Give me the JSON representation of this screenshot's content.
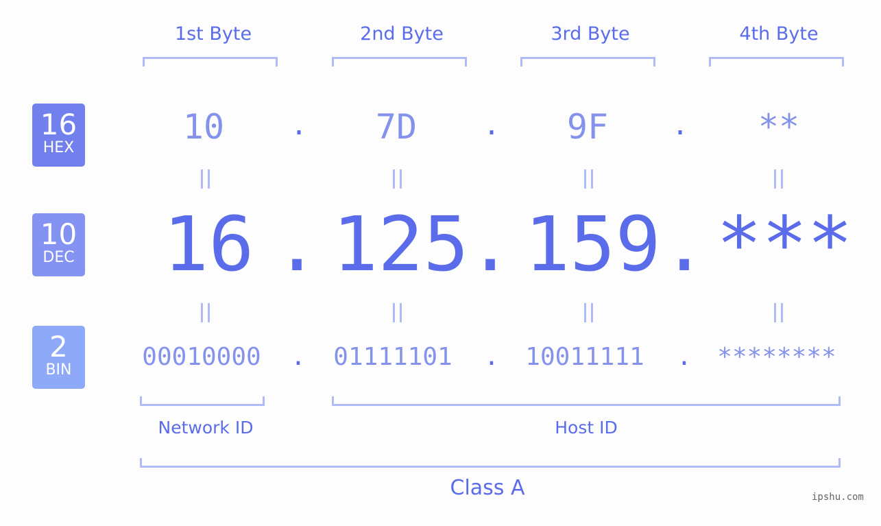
{
  "bytes": [
    {
      "label": "1st Byte",
      "hex": "10",
      "dec": "16",
      "bin": "00010000"
    },
    {
      "label": "2nd Byte",
      "hex": "7D",
      "dec": "125",
      "bin": "01111101"
    },
    {
      "label": "3rd Byte",
      "hex": "9F",
      "dec": "159",
      "bin": "10011111"
    },
    {
      "label": "4th Byte",
      "hex": "**",
      "dec": "***",
      "bin": "********"
    }
  ],
  "separator": ".",
  "badges": {
    "hex": {
      "num": "16",
      "label": "HEX",
      "color": "#7180ec"
    },
    "dec": {
      "num": "10",
      "label": "DEC",
      "color": "#8493f2"
    },
    "bin": {
      "num": "2",
      "label": "BIN",
      "color": "#8ea9f8"
    }
  },
  "network_id_label": "Network ID",
  "host_id_label": "Host ID",
  "class_label": "Class A",
  "watermark": "ipshu.com",
  "colors": {
    "accent": "#5a6cea",
    "muted": "#8592ec",
    "bracket": "#b1bbf8"
  }
}
